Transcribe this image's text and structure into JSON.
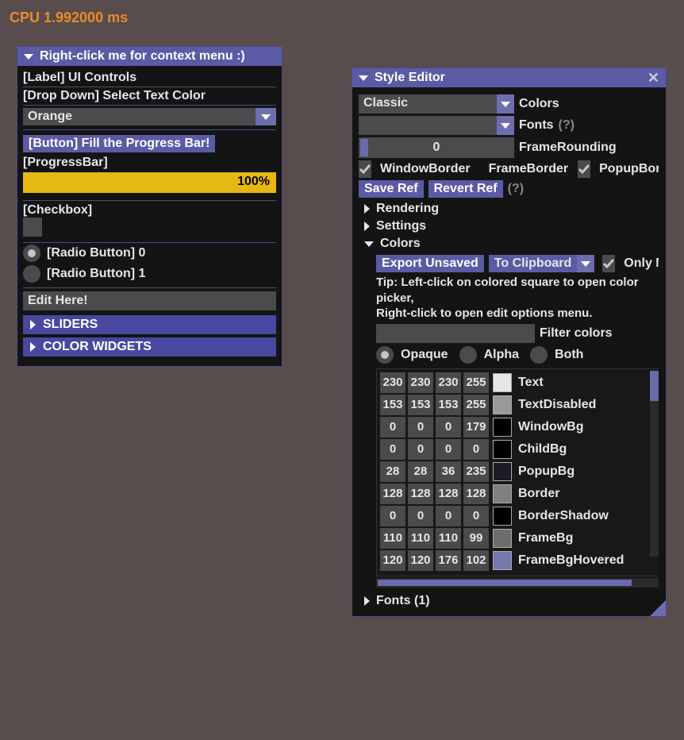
{
  "cpu": "CPU 1.992000 ms",
  "win1": {
    "title": "Right-click me for context menu :)",
    "label_ui": "[Label] UI Controls",
    "dd_label": "[Drop Down] Select Text Color",
    "dd_value": "Orange",
    "btn_fill": "[Button] Fill the Progress Bar!",
    "pb_label": "[ProgressBar]",
    "pb_pct": "100%",
    "chk_label": "[Checkbox]",
    "radio0": "[Radio Button] 0",
    "radio1": "[Radio Button] 1",
    "edit_value": "Edit Here!",
    "sliders": "SLIDERS",
    "colorwidgets": "COLOR WIDGETS"
  },
  "win2": {
    "title": "Style Editor",
    "color_combo": "Classic",
    "color_label": "Colors",
    "fonts_label": "Fonts",
    "frame_rounding_val": "0",
    "frame_rounding_lbl": "FrameRounding",
    "wb": "WindowBorder",
    "fb": "FrameBorder",
    "pb": "PopupBorder",
    "save_ref": "Save Ref",
    "revert_ref": "Revert Ref",
    "rendering": "Rendering",
    "settings": "Settings",
    "colors_tree": "Colors",
    "export_unsaved": "Export Unsaved",
    "to_clipboard": "To Clipboard",
    "only_modif": "Only Modified",
    "tip1": "Tip: Left-click on colored square to open color picker,",
    "tip2": "Right-click to open edit options menu.",
    "filter_lbl": "Filter colors",
    "r_opaque": "Opaque",
    "r_alpha": "Alpha",
    "r_both": "Both",
    "colors": [
      {
        "n": "Text",
        "v": [
          230,
          230,
          230,
          255
        ],
        "c": "#e6e6e6"
      },
      {
        "n": "TextDisabled",
        "v": [
          153,
          153,
          153,
          255
        ],
        "c": "#999999"
      },
      {
        "n": "WindowBg",
        "v": [
          0,
          0,
          0,
          179
        ],
        "c": "#000000"
      },
      {
        "n": "ChildBg",
        "v": [
          0,
          0,
          0,
          0
        ],
        "c": "#000000"
      },
      {
        "n": "PopupBg",
        "v": [
          28,
          28,
          36,
          235
        ],
        "c": "#1c1c24"
      },
      {
        "n": "Border",
        "v": [
          128,
          128,
          128,
          128
        ],
        "c": "#808080"
      },
      {
        "n": "BorderShadow",
        "v": [
          0,
          0,
          0,
          0
        ],
        "c": "#000000"
      },
      {
        "n": "FrameBg",
        "v": [
          110,
          110,
          110,
          99
        ],
        "c": "#6e6e6e"
      },
      {
        "n": "FrameBgHovered",
        "v": [
          120,
          120,
          176,
          102
        ],
        "c": "#7878b0"
      }
    ],
    "fonts_tree": "Fonts (1)"
  }
}
